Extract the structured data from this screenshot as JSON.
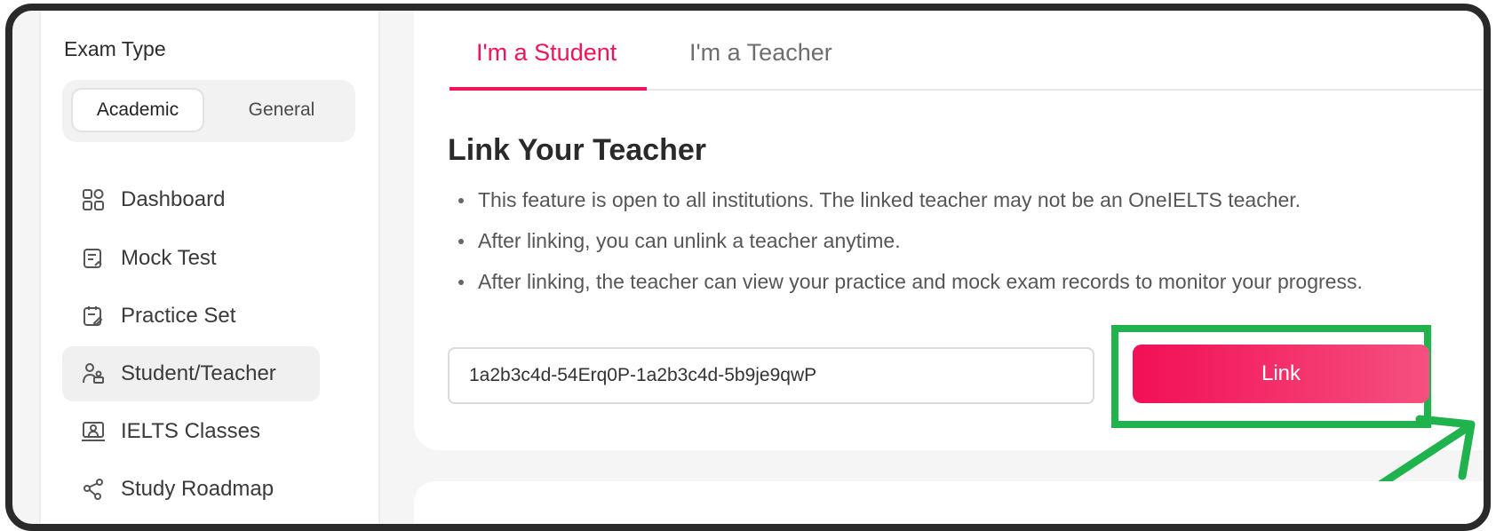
{
  "sidebar": {
    "exam_type_label": "Exam Type",
    "exam_type_options": [
      "Academic",
      "General"
    ],
    "selected_exam_type": "Academic",
    "nav_items": [
      {
        "label": "Dashboard",
        "icon": "dashboard-icon"
      },
      {
        "label": "Mock Test",
        "icon": "mock-test-icon"
      },
      {
        "label": "Practice Set",
        "icon": "practice-set-icon"
      },
      {
        "label": "Student/Teacher",
        "icon": "student-teacher-icon"
      },
      {
        "label": "IELTS Classes",
        "icon": "ielts-classes-icon"
      },
      {
        "label": "Study Roadmap",
        "icon": "roadmap-icon"
      }
    ],
    "active_item": "Student/Teacher"
  },
  "main": {
    "tabs": [
      {
        "label": "I'm a Student"
      },
      {
        "label": "I'm a Teacher"
      }
    ],
    "active_tab": "I'm a Student",
    "heading": "Link Your Teacher",
    "bullets": [
      "This feature is open to all institutions. The linked teacher may not be an OneIELTS teacher.",
      "After linking, you can unlink a teacher anytime.",
      "After linking, the teacher can view your practice and mock exam records to monitor your progress."
    ],
    "code_input_value": "1a2b3c4d-54Erq0P-1a2b3c4d-5b9je9qwP",
    "link_button_label": "Link"
  },
  "colors": {
    "accent": "#f0145a",
    "highlight": "#1fb24d",
    "frame": "#2a2a2a"
  }
}
